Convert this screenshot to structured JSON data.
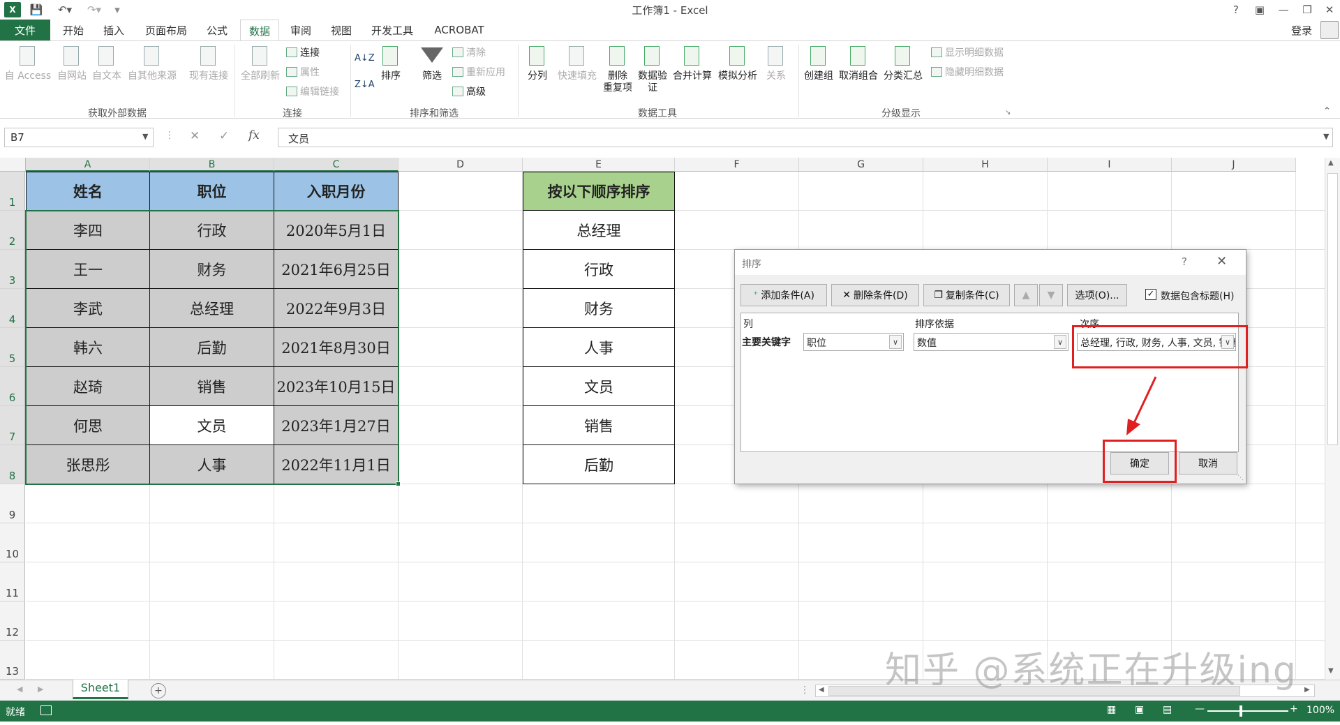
{
  "window": {
    "title": "工作簿1 - Excel",
    "help": "?",
    "signin": "登录"
  },
  "tabs": [
    {
      "label": "文件"
    },
    {
      "label": "开始"
    },
    {
      "label": "插入"
    },
    {
      "label": "页面布局"
    },
    {
      "label": "公式"
    },
    {
      "label": "数据"
    },
    {
      "label": "审阅"
    },
    {
      "label": "视图"
    },
    {
      "label": "开发工具"
    },
    {
      "label": "ACROBAT"
    }
  ],
  "ribbon": {
    "get_external": {
      "access": "自 Access",
      "web": "自网站",
      "text": "自文本",
      "other": "自其他来源",
      "existing": "现有连接",
      "group": "获取外部数据"
    },
    "connections": {
      "refresh_all": "全部刷新",
      "connections": "连接",
      "properties": "属性",
      "edit_links": "编辑链接",
      "group": "连接"
    },
    "sort_filter": {
      "sort": "排序",
      "filter": "筛选",
      "clear": "清除",
      "reapply": "重新应用",
      "advanced": "高级",
      "group": "排序和筛选"
    },
    "data_tools": {
      "text_to_columns": "分列",
      "flash_fill": "快速填充",
      "remove_dup_1": "删除",
      "remove_dup_2": "重复项",
      "validation_1": "数据验",
      "validation_2": "证",
      "consolidate": "合并计算",
      "what_if": "模拟分析",
      "relationships": "关系",
      "group": "数据工具"
    },
    "outline": {
      "group_btn": "创建组",
      "ungroup": "取消组合",
      "subtotal": "分类汇总",
      "show_detail": "显示明细数据",
      "hide_detail": "隐藏明细数据",
      "group": "分级显示"
    }
  },
  "formula_bar": {
    "name_box": "B7",
    "value": "文员",
    "fx": "fx"
  },
  "columns": [
    "A",
    "B",
    "C",
    "D",
    "E",
    "F",
    "G",
    "H",
    "I",
    "J"
  ],
  "rows": [
    "1",
    "2",
    "3",
    "4",
    "5",
    "6",
    "7",
    "8",
    "9",
    "10",
    "11",
    "12",
    "13"
  ],
  "table": {
    "headers": [
      "姓名",
      "职位",
      "入职月份"
    ],
    "rows": [
      [
        "李四",
        "行政",
        "2020年5月1日"
      ],
      [
        "王一",
        "财务",
        "2021年6月25日"
      ],
      [
        "李武",
        "总经理",
        "2022年9月3日"
      ],
      [
        "韩六",
        "后勤",
        "2021年8月30日"
      ],
      [
        "赵琦",
        "销售",
        "2023年10月15日"
      ],
      [
        "何思",
        "文员",
        "2023年1月27日"
      ],
      [
        "张思彤",
        "人事",
        "2022年11月1日"
      ]
    ]
  },
  "order_list": {
    "header": "按以下顺序排序",
    "items": [
      "总经理",
      "行政",
      "财务",
      "人事",
      "文员",
      "销售",
      "后勤"
    ]
  },
  "dialog": {
    "title": "排序",
    "help": "?",
    "add": "添加条件(A)",
    "delete": "删除条件(D)",
    "copy": "复制条件(C)",
    "options": "选项(O)...",
    "has_headers": "数据包含标题(H)",
    "col_header": "列",
    "sorton_header": "排序依据",
    "order_header": "次序",
    "primary_key": "主要关键字",
    "column_value": "职位",
    "sort_on_value": "数值",
    "order_value": "总经理, 行政, 财务, 人事, 文员, 销售, 后勤",
    "ok": "确定",
    "cancel": "取消"
  },
  "sheet_tab": "Sheet1",
  "status": {
    "ready": "就绪",
    "zoom": "100%"
  },
  "watermark": "知乎 @系统正在升级ing",
  "colors": {
    "excel_green": "#217346",
    "header_blue": "#9cc3e6",
    "header_green": "#a9d18e",
    "cell_gray": "#cdcdcd",
    "highlight_red": "#e02020"
  }
}
